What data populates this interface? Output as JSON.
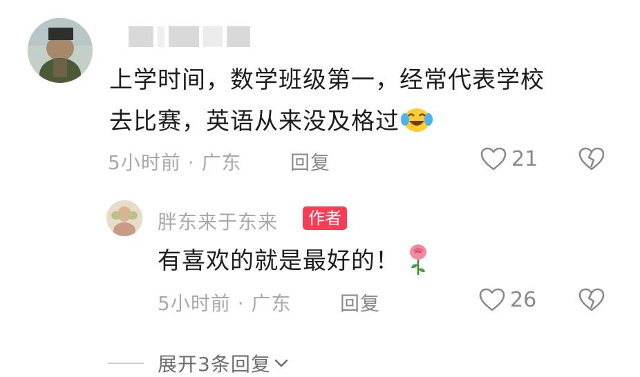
{
  "main_comment": {
    "text_line1": "上学时间，数学班级第一，经常代表学校",
    "text_line2": "去比赛，英语从来没及格过",
    "meta": "5小时前 · 广东",
    "reply_label": "回复",
    "like_count": "21"
  },
  "reply_comment": {
    "username": "胖东来于东来",
    "badge": "作者",
    "text": "有喜欢的就是最好的！",
    "meta": "5小时前 · 广东",
    "reply_label": "回复",
    "like_count": "26"
  },
  "expand": {
    "label": "展开3条回复"
  },
  "colors": {
    "badge": "#fa3d55",
    "text": "#1c1c1c",
    "meta": "#a9a9a9"
  }
}
